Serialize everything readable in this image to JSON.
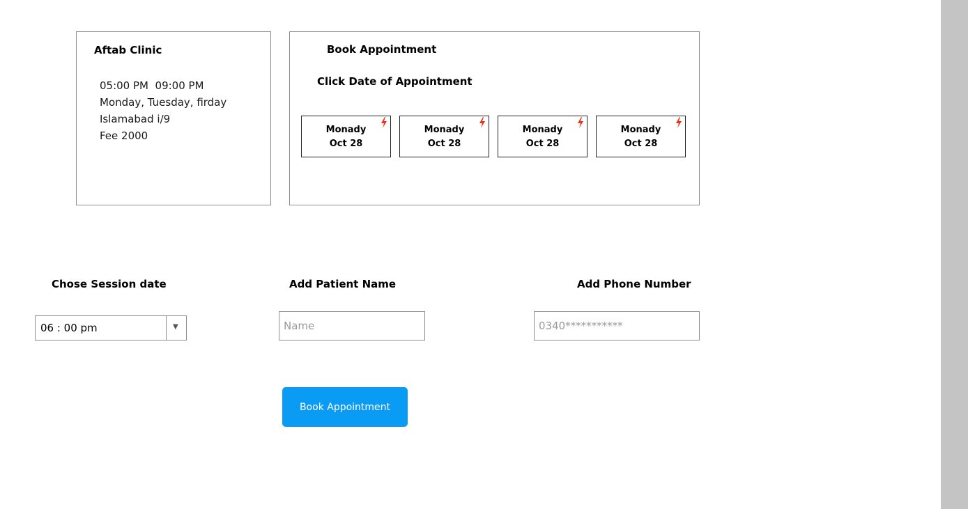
{
  "clinic": {
    "name": "Aftab Clinic",
    "hours": "05:00 PM  09:00 PM",
    "days": "Monday, Tuesday, firday",
    "location": "Islamabad i/9",
    "fee": "Fee 2000"
  },
  "booking": {
    "title": "Book Appointment",
    "subtitle": "Click Date of Appointment",
    "dates": [
      {
        "day": "Monady",
        "date": "Oct 28"
      },
      {
        "day": "Monady",
        "date": "Oct 28"
      },
      {
        "day": "Monady",
        "date": "Oct 28"
      },
      {
        "day": "Monady",
        "date": "Oct 28"
      }
    ],
    "flash_icon": "lightning-icon",
    "flash_color": "#e8341c"
  },
  "form": {
    "session_label": "Chose Session date",
    "session_value": "06 : 00 pm",
    "patient_label": "Add Patient Name",
    "patient_placeholder": "Name",
    "phone_label": "Add Phone Number",
    "phone_placeholder": "0340***********",
    "submit_label": "Book Appointment",
    "submit_color": "#0a9cf5"
  }
}
